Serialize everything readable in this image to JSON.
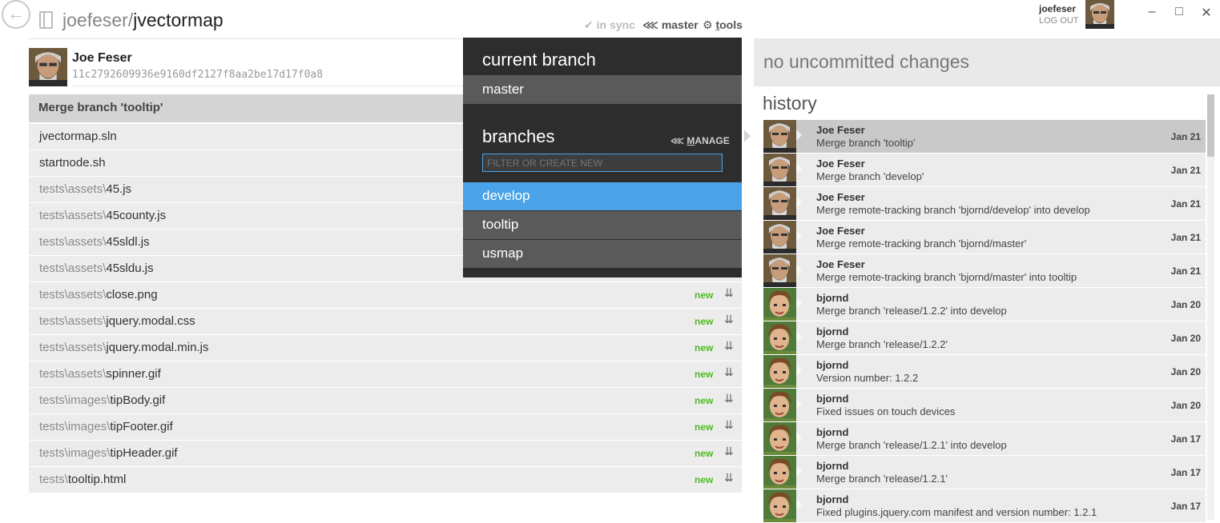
{
  "header": {
    "back_icon": "arrow-left-circle-icon",
    "repo_owner": "joefeser/",
    "repo_name": "jvectormap",
    "sync_status": "in sync",
    "current_branch": "master",
    "tools_label_first": "t",
    "tools_label_rest": "ools"
  },
  "user": {
    "name": "joefeser",
    "logout": "LOG OUT"
  },
  "window": {
    "minimize": "–",
    "maximize": "□",
    "close": "✕"
  },
  "commit": {
    "author": "Joe Feser",
    "sha": "11c2792609936e9160df2127f8aa2be17d17f0a8",
    "message": "Merge branch 'tooltip'"
  },
  "files": [
    {
      "dir": "",
      "name": "jvectormap.sln",
      "status": ""
    },
    {
      "dir": "",
      "name": "startnode.sh",
      "status": ""
    },
    {
      "dir": "tests\\assets\\",
      "name": "45.js",
      "status": ""
    },
    {
      "dir": "tests\\assets\\",
      "name": "45county.js",
      "status": ""
    },
    {
      "dir": "tests\\assets\\",
      "name": "45sldl.js",
      "status": ""
    },
    {
      "dir": "tests\\assets\\",
      "name": "45sldu.js",
      "status": ""
    },
    {
      "dir": "tests\\assets\\",
      "name": "close.png",
      "status": "new"
    },
    {
      "dir": "tests\\assets\\",
      "name": "jquery.modal.css",
      "status": "new"
    },
    {
      "dir": "tests\\assets\\",
      "name": "jquery.modal.min.js",
      "status": "new"
    },
    {
      "dir": "tests\\assets\\",
      "name": "spinner.gif",
      "status": "new"
    },
    {
      "dir": "tests\\images\\",
      "name": "tipBody.gif",
      "status": "new"
    },
    {
      "dir": "tests\\images\\",
      "name": "tipFooter.gif",
      "status": "new"
    },
    {
      "dir": "tests\\images\\",
      "name": "tipHeader.gif",
      "status": "new"
    },
    {
      "dir": "tests\\",
      "name": "tooltip.html",
      "status": "new"
    }
  ],
  "branch_popup": {
    "current_heading": "current branch",
    "current_branch": "master",
    "branches_heading": "branches",
    "manage_first": "M",
    "manage_rest": "ANAGE",
    "filter_placeholder": "FILTER OR CREATE NEW",
    "branches": [
      "develop",
      "tooltip",
      "usmap"
    ],
    "selected_branch": "develop"
  },
  "changes": {
    "label": "no uncommitted changes"
  },
  "history": {
    "heading": "history",
    "items": [
      {
        "author": "Joe Feser",
        "message": "Merge branch 'tooltip'",
        "date": "Jan 21"
      },
      {
        "author": "Joe Feser",
        "message": "Merge branch 'develop'",
        "date": "Jan 21"
      },
      {
        "author": "Joe Feser",
        "message": "Merge remote-tracking branch 'bjornd/develop' into develop",
        "date": "Jan 21"
      },
      {
        "author": "Joe Feser",
        "message": "Merge remote-tracking branch 'bjornd/master'",
        "date": "Jan 21"
      },
      {
        "author": "Joe Feser",
        "message": "Merge remote-tracking branch 'bjornd/master' into tooltip",
        "date": "Jan 21"
      },
      {
        "author": "bjornd",
        "message": "Merge branch 'release/1.2.2' into develop",
        "date": "Jan 20"
      },
      {
        "author": "bjornd",
        "message": "Merge branch 'release/1.2.2'",
        "date": "Jan 20"
      },
      {
        "author": "bjornd",
        "message": "Version number: 1.2.2",
        "date": "Jan 20"
      },
      {
        "author": "bjornd",
        "message": "Fixed issues on touch devices",
        "date": "Jan 20"
      },
      {
        "author": "bjornd",
        "message": "Merge branch 'release/1.2.1' into develop",
        "date": "Jan 17"
      },
      {
        "author": "bjornd",
        "message": "Merge branch 'release/1.2.1'",
        "date": "Jan 17"
      },
      {
        "author": "bjornd",
        "message": "Fixed plugins.jquery.com manifest and version number: 1.2.1",
        "date": "Jan 17"
      }
    ]
  },
  "colors": {
    "accent": "#4aa3e8",
    "new_status": "#4cba1f",
    "popup_bg": "#2d2d2d"
  }
}
